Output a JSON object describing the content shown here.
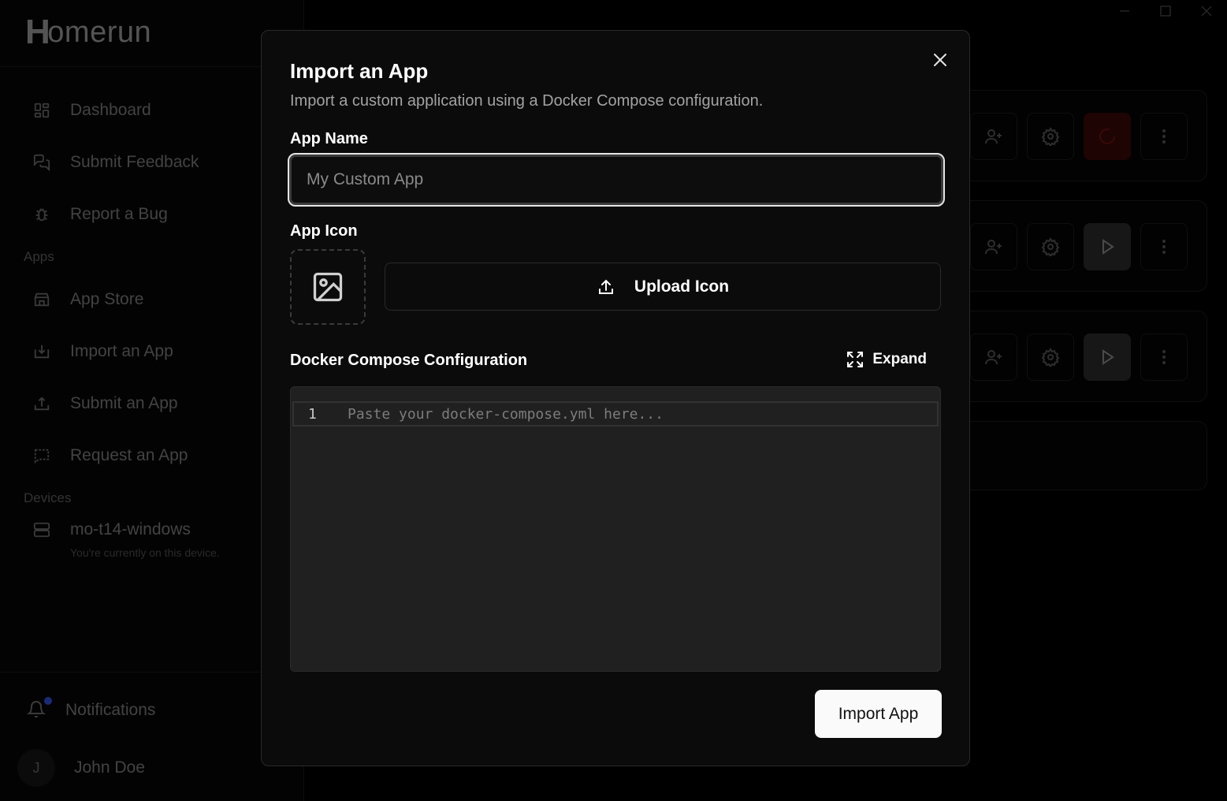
{
  "app": {
    "logo_mark": "H",
    "logo_rest": "omerun"
  },
  "sidebar": {
    "items": [
      {
        "label": "Dashboard",
        "icon": "dashboard-icon"
      },
      {
        "label": "Submit Feedback",
        "icon": "feedback-icon"
      },
      {
        "label": "Report a Bug",
        "icon": "bug-icon"
      }
    ],
    "apps_section": "Apps",
    "apps_items": [
      {
        "label": "App Store",
        "icon": "store-icon"
      },
      {
        "label": "Import an App",
        "icon": "import-icon"
      },
      {
        "label": "Submit an App",
        "icon": "upload-icon"
      },
      {
        "label": "Request an App",
        "icon": "message-icon"
      }
    ],
    "devices_section": "Devices",
    "device": {
      "name": "mo-t14-windows",
      "subtitle": "You're currently on this device.",
      "icon": "server-icon"
    },
    "notifications_label": "Notifications",
    "user": {
      "initial": "J",
      "name": "John Doe"
    }
  },
  "modal": {
    "title": "Import an App",
    "description": "Import a custom application using a Docker Compose configuration.",
    "app_name_label": "App Name",
    "app_name_placeholder": "My Custom App",
    "app_name_value": "",
    "app_icon_label": "App Icon",
    "upload_label": "Upload Icon",
    "compose_label": "Docker Compose Configuration",
    "expand_label": "Expand",
    "editor": {
      "line_number": "1",
      "placeholder": "Paste your docker-compose.yml here..."
    },
    "submit_label": "Import App"
  },
  "colors": {
    "accent": "#2d4fd8",
    "danger_bg": "#3a0808",
    "primary_btn": "#fafafa"
  }
}
